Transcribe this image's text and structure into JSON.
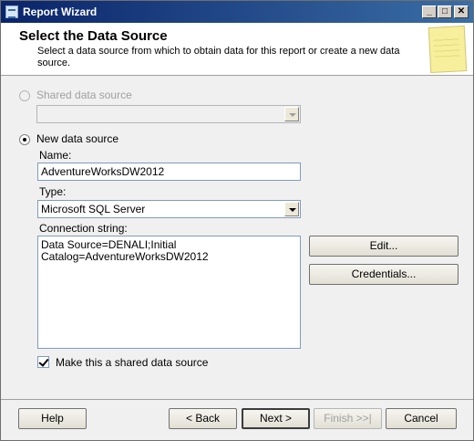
{
  "window": {
    "title": "Report Wizard"
  },
  "header": {
    "title": "Select the Data Source",
    "description": "Select a data source from which to obtain data for this report or create a new data source."
  },
  "shared_source": {
    "label": "Shared data source",
    "selected": false,
    "enabled": false,
    "value": ""
  },
  "new_source": {
    "label": "New data source",
    "selected": true,
    "name_label": "Name:",
    "name_value": "AdventureWorksDW2012",
    "type_label": "Type:",
    "type_value": "Microsoft SQL Server",
    "conn_label": "Connection string:",
    "conn_value": "Data Source=DENALI;Initial\nCatalog=AdventureWorksDW2012",
    "edit_label": "Edit...",
    "credentials_label": "Credentials..."
  },
  "make_shared": {
    "label": "Make this a shared data source",
    "checked": true
  },
  "footer": {
    "help": "Help",
    "back": "< Back",
    "next": "Next >",
    "finish": "Finish >>|",
    "cancel": "Cancel"
  }
}
